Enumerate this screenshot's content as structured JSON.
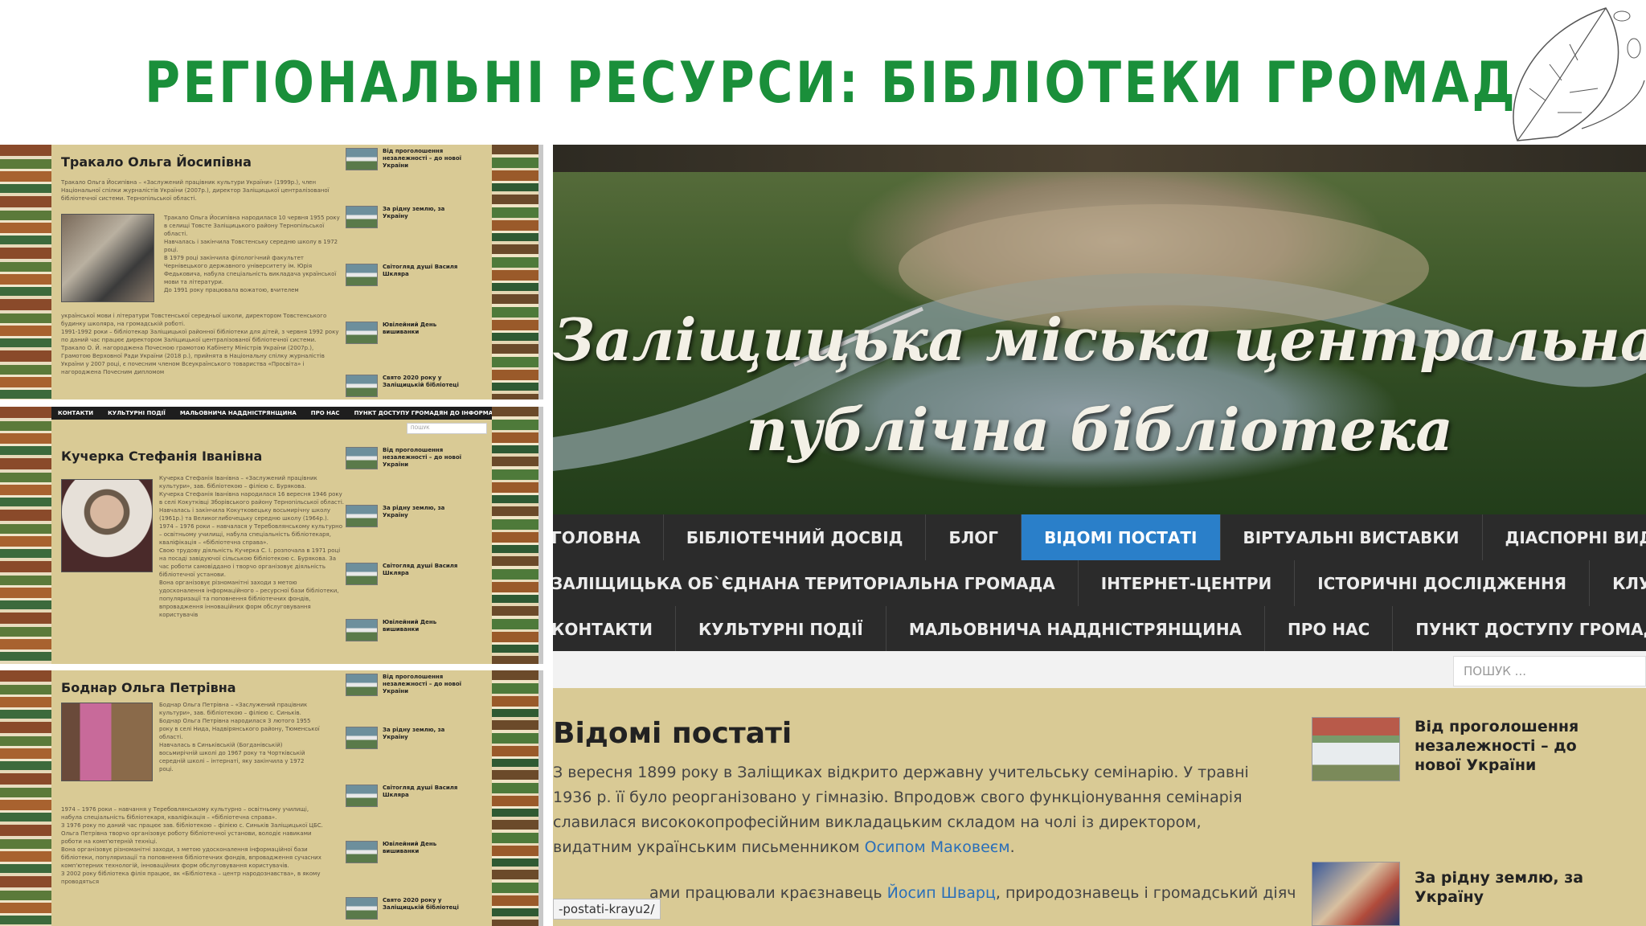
{
  "slide": {
    "title": "РЕГІОНАЛЬНІ РЕСУРСИ: БІБЛІОТЕКИ ГРОМАД"
  },
  "left_shots": [
    {
      "name": "Тракало Ольга Йосипівна",
      "intro": "Тракало Ольга Йосипівна – «Заслужений працівник культури України» (1999р.), член Національної спілки журналістів України (2007р.), директор Заліщицької централізованої бібліотечної системи. Тернопільської області.",
      "bio": "Тракало Ольга Йосипівна народилася 10 червня 1955 року в селищі Товсте Заліщицького району Тернопільської області.\nНавчалась і закінчила Товстенську середню школу в 1972 році.\nВ 1979 році закінчила філологічний факультет Чернівецького державного університету ім. Юрія Федьковича, набула спеціальність викладача української мови та літератури.\nДо 1991 року працювала вожатою, вчителем",
      "bio2": "української мови і літератури Товстенської середньої школи, директором Товстенського будинку школяра, на громадській роботі.\n1991-1992 роки – бібліотекар Заліщицької районної бібліотеки для дітей, з червня 1992 року по даний час працює директором Заліщицької централізованої бібліотечної системи.\nТракало О. Й. нагороджена Почесною грамотою Кабінету Міністрів України (2007р.), Грамотою Верховної Ради України (2018 р.), прийнята в Національну спілку журналістів України у 2007 році, є почесним членом Всеукраїнського товариства «Просвіта» і нагороджена Почесним дипломом",
      "side": [
        "Від проголошення незалежності – до нової України",
        "За рідну землю, за Україну",
        "Світогляд душі Василя Шкляра",
        "Ювілейний День вишиванки",
        "Свято 2020 року у Заліщицькій бібліотеці"
      ]
    },
    {
      "nav": [
        "КОНТАКТИ",
        "КУЛЬТУРНІ ПОДІЇ",
        "МАЛЬОВНИЧА НАДДНІСТРЯНЩИНА",
        "ПРО НАС",
        "ПУНКТ ДОСТУПУ ГРОМАДЯН ДО ІНФОРМАЦІЇ"
      ],
      "search": "ПОШУК",
      "name": "Кучерка Стефанія Іванівна",
      "bio": "Кучерка Стефанія Іванівна – «Заслужений працівник культури», зав. бібліотекою – філією с. Бурякова.\nКучерка Стефанія Іванівна народилася 16 вересня 1946 року в селі Кокутківці Зборівського району Тернопільської області.\nНавчалась і закінчила Кокутковецьку восьмирічну школу (1961р.) та Великоглибочецьку середню школу (1964р.).\n1974 – 1976 роки – навчалася у Теребовлянському культурно – освітньому училищі, набула спеціальність бібліотекаря, кваліфікація – «бібліотечна справа».\nСвою трудову діяльність Кучерка С. І. розпочала в 1971 році на посаді завідуючої сільською бібліотекою с. Бурякова. За час роботи самовіддано і творчо організовує діяльність бібліотечної установи.\nВона організовує різноманітні заходи з метою удосконалення інформаційного – ресурсної бази бібліотеки, популяризації та поповнення бібліотечних фондів, впровадження інноваційних форм обслуговування користувачів",
      "side": [
        "Від проголошення незалежності – до нової України",
        "За рідну землю, за Україну",
        "Світогляд душі Василя Шкляра",
        "Ювілейний День вишиванки"
      ]
    },
    {
      "name": "Боднар Ольга Петрівна",
      "bio": "Боднар Ольга Петрівна – «Заслужений працівник культури», зав. бібліотекою – філією с. Синьків.\nБоднар Ольга Петрівна народилася 3 лютого 1955 року в селі Нида, Надвірянського району, Тюменської області.\nНавчалась в Синьківській (Богданівській) восьмирічній школі до 1967 року та Чортківській середній школі – інтернаті, яку закінчила у 1972 році.",
      "bio2": "1974 – 1976 роки – навчання у Теребовлянському культурно – освітньому училищі, набула спеціальність бібліотекаря, кваліфікація – «бібліотечна справа».\nЗ 1976 року по даний час працює зав. бібліотекою – філією с. Синьків Заліщицької ЦБС.\nОльга Петрівна творчо організовує роботу бібліотечної установи, володіє навиками роботи на комп'ютерній техніці.\nВона організовує різноманітні заходи, з метою удосконалення інформаційної бази бібліотеки, популяризації та поповнення бібліотечних фондів, впровадження сучасних комп'ютерних технологій, інноваційних форм обслуговування користувачів.\nЗ 2002 року бібліотека філія працює, як «Бібліотека – центр народознавства», в якому проводяться",
      "side": [
        "Від проголошення незалежності – до нової України",
        "За рідну землю, за Україну",
        "Світогляд душі Василя Шкляра",
        "Ювілейний День вишиванки",
        "Свято 2020 року у Заліщицькій бібліотеці"
      ]
    }
  ],
  "main": {
    "banner_line1": "Заліщицька міська центральна",
    "banner_line2": "публічна бібліотека",
    "nav_rows": [
      [
        "ГОЛОВНА",
        "БІБЛІОТЕЧНИЙ ДОСВІД",
        "БЛОГ",
        "ВІДОМІ ПОСТАТІ",
        "ВІРТУАЛЬНІ ВИСТАВКИ",
        "ДІАСПОРНІ ВИДАННЯ"
      ],
      [
        "ЗАЛІЩИЦЬКА ОБ`ЄДНАНА ТЕРИТОРІАЛЬНА ГРОМАДА",
        "ІНТЕРНЕТ-ЦЕНТРИ",
        "ІСТОРИЧНІ ДОСЛІДЖЕННЯ",
        "КЛУБ ТВОРЧОЇ МОЛОДІ"
      ],
      [
        "КОНТАКТИ",
        "КУЛЬТУРНІ ПОДІЇ",
        "МАЛЬОВНИЧА НАДДНІСТРЯНЩИНА",
        "ПРО НАС",
        "ПУНКТ ДОСТУПУ ГРОМАДЯН ДО ІНФОРМАЦІЇ"
      ]
    ],
    "active_nav": "ВІДОМІ ПОСТАТІ",
    "search_placeholder": "ПОШУК ...",
    "page_title": "Відомі постаті",
    "paragraph": "З вересня 1899 року в Заліщиках відкрито державну учительську семінарію. У травні 1936 р. її було реорганізовано у гімназію. Впродовж свого функціонування семінарія славилася висококопрофесійним викладацьким складом на чолі із директором, видатним українським письменником ",
    "paragraph_link": "Осипом Маковеєм",
    "paragraph_end": ".",
    "p2_start": "ами працювали краєзнавець ",
    "p2_link": "Йосип Шварц",
    "p2_end": ", природознавець і громадський діяч",
    "url_tip": "-postati-krayu2/",
    "sidebar": [
      "Від проголошення незалежності – до нової України",
      "За рідну землю, за Україну"
    ]
  }
}
